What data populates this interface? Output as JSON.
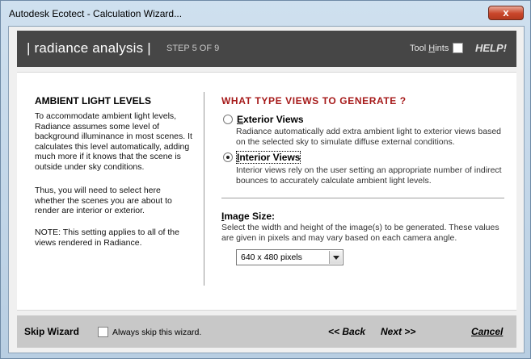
{
  "window": {
    "title": "Autodesk Ecotect - Calculation Wizard...",
    "close_label": "x"
  },
  "header": {
    "title": "| radiance analysis |",
    "step": "STEP 5 OF 9",
    "tool_hints_prefix": "Tool ",
    "tool_hints_underlined": "H",
    "tool_hints_suffix": "ints",
    "tool_hints_checked": false,
    "help_label": "HELP!"
  },
  "left": {
    "heading": "AMBIENT LIGHT LEVELS",
    "para1": "To accommodate ambient light levels, Radiance assumes some level of background illuminance in most scenes. It calculates this level automatically, adding much more if it knows that the scene is outside under sky conditions.",
    "para2": "Thus, you will need to select here whether the scenes you are about to render are interior or exterior.",
    "para3": "NOTE: This setting applies to all of the views rendered in Radiance."
  },
  "right": {
    "heading": "WHAT TYPE VIEWS TO GENERATE ?",
    "options": [
      {
        "first_letter": "E",
        "label_rest": "xterior Views",
        "description": "Radiance automatically add extra ambient light to exterior views based on the selected sky to simulate diffuse external conditions.",
        "checked": false
      },
      {
        "first_letter": "I",
        "label_rest": "nterior Views",
        "description": "Interior views rely on the user setting an appropriate number of indirect bounces to accurately calculate ambient light levels.",
        "checked": true
      }
    ],
    "image_size": {
      "heading_underlined": "I",
      "heading_rest": "mage Size:",
      "description": "Select the width and height of the image(s) to be generated.  These values are given in pixels and may vary based on each camera angle.",
      "selected": "640 x 480 pixels"
    }
  },
  "footer": {
    "skip_title": "Skip Wizard",
    "skip_checkbox_label": "Always skip this wizard.",
    "skip_checked": false,
    "back_label": "<< Back",
    "next_label": "Next >>",
    "cancel_label": "Cancel"
  }
}
